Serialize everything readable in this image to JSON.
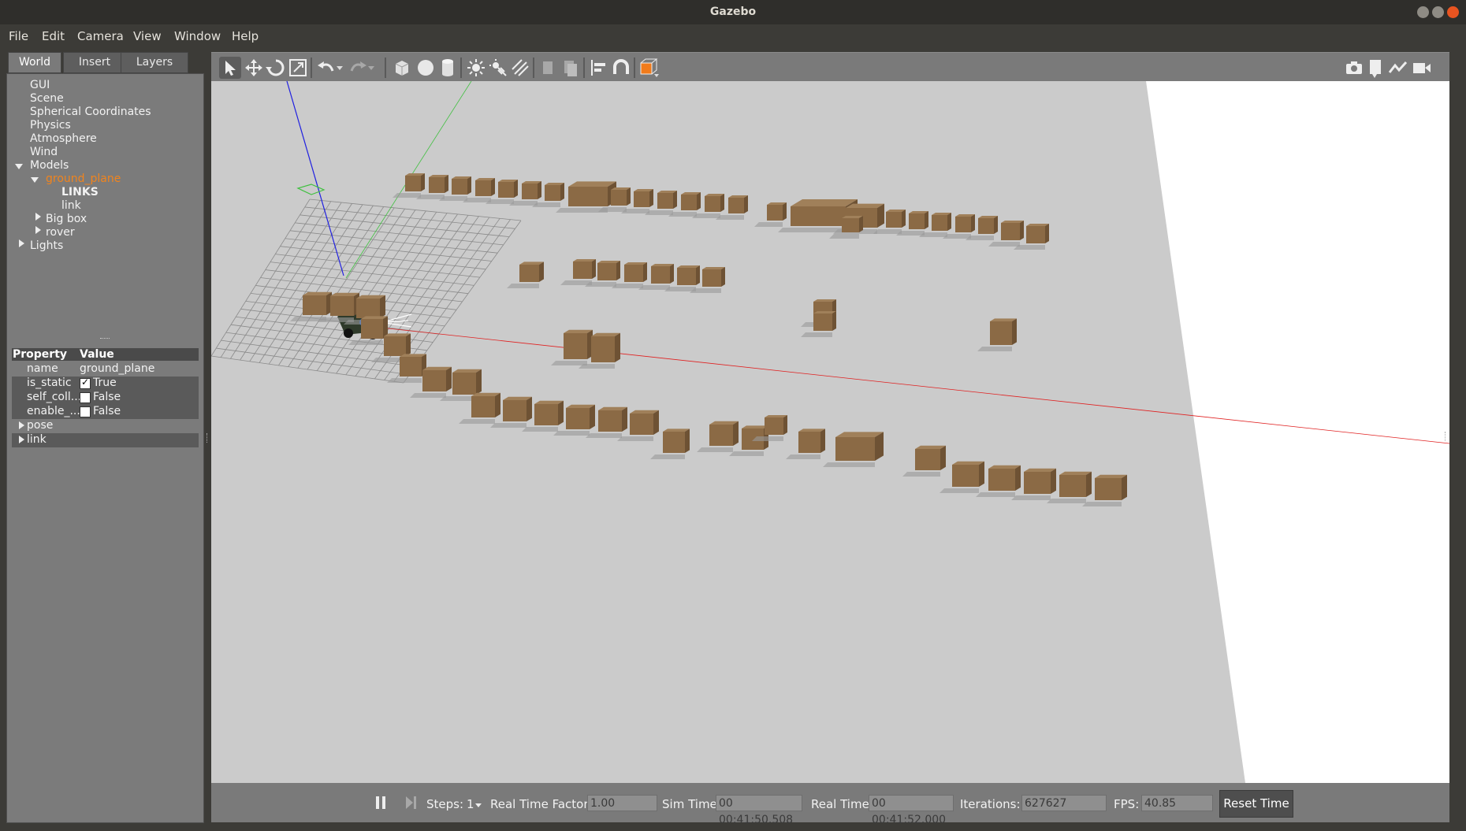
{
  "window": {
    "title": "Gazebo"
  },
  "menu": [
    "File",
    "Edit",
    "Camera",
    "View",
    "Window",
    "Help"
  ],
  "tabs": [
    "World",
    "Insert",
    "Layers"
  ],
  "tree": {
    "items": [
      "GUI",
      "Scene",
      "Spherical Coordinates",
      "Physics",
      "Atmosphere",
      "Wind"
    ],
    "models": "Models",
    "ground_plane": "ground_plane",
    "links_header": "LINKS",
    "link": "link",
    "big_box": "Big box",
    "rover": "rover",
    "lights": "Lights"
  },
  "properties": {
    "header_property": "Property",
    "header_value": "Value",
    "rows": [
      {
        "name": "name",
        "value": "ground_plane"
      },
      {
        "name": "is_static",
        "value": "True",
        "checked": true
      },
      {
        "name": "self_coll...",
        "value": "False",
        "checked": false
      },
      {
        "name": "enable_...",
        "value": "False",
        "checked": false
      }
    ],
    "expandable": [
      "pose",
      "link"
    ]
  },
  "toolbar": {
    "icons": [
      "select-icon",
      "translate-icon",
      "rotate-icon",
      "scale-icon",
      "undo-icon",
      "undo-dropdown-icon",
      "redo-icon",
      "redo-dropdown-icon",
      "box-icon",
      "sphere-icon",
      "cylinder-icon",
      "point-light-icon",
      "spot-light-icon",
      "directional-light-icon",
      "copy-icon",
      "paste-icon",
      "align-icon",
      "snap-icon",
      "view-angle-icon"
    ],
    "right_icons": [
      "screenshot-icon",
      "log-icon",
      "plot-icon",
      "video-icon"
    ]
  },
  "bottom": {
    "steps_label": "Steps:",
    "steps_value": "1",
    "rtf_label": "Real Time Factor:",
    "rtf_value": "1.00",
    "sim_label": "Sim Time:",
    "sim_value": "00 00:41:50.508",
    "real_label": "Real Time:",
    "real_value": "00 00:41:52.000",
    "iter_label": "Iterations:",
    "iter_value": "627627",
    "fps_label": "FPS:",
    "fps_value": "40.85",
    "reset_label": "Reset Time"
  },
  "colors": {
    "selected": "#f0841e",
    "box": "#8b6a45",
    "ground": "#cbcbcb",
    "axis_x": "#e02020",
    "axis_y": "#40c040",
    "axis_z": "#2020e0"
  }
}
